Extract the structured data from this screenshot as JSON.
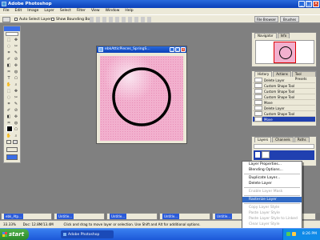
{
  "app": {
    "title": "Adobe Photoshop"
  },
  "menu": [
    "File",
    "Edit",
    "Image",
    "Layer",
    "Select",
    "Filter",
    "View",
    "Window",
    "Help"
  ],
  "options_bar": {
    "auto_select": "Auto Select Layer",
    "bounding": "Show Bounding Box",
    "tab1": "File Browser",
    "tab2": "Brushes"
  },
  "document": {
    "title": "ebkAtticPieces_SpringS..."
  },
  "navigator": {
    "tabs": [
      "Navigator",
      "Info"
    ]
  },
  "history": {
    "tabs": [
      "History",
      "Actions",
      "Tool Presets"
    ],
    "items": [
      "Delete Layer",
      "Custom Shape Tool",
      "Custom Shape Tool",
      "Custom Shape Tool",
      "Move",
      "Delete Layer",
      "Custom Shape Tool",
      "Move"
    ],
    "selected_index": 7
  },
  "layers": {
    "tabs": [
      "Layers",
      "Channels",
      "Paths"
    ]
  },
  "context_menu": {
    "items": [
      {
        "label": "Layer Properties...",
        "enabled": true
      },
      {
        "label": "Blending Options...",
        "enabled": true
      },
      {
        "sep": true
      },
      {
        "label": "Duplicate Layer...",
        "enabled": true
      },
      {
        "label": "Delete Layer",
        "enabled": true
      },
      {
        "sep": true
      },
      {
        "label": "Enable Layer Mask",
        "enabled": false
      },
      {
        "sep": true
      },
      {
        "label": "Rasterize Layer",
        "enabled": true,
        "highlight": true
      },
      {
        "sep": true
      },
      {
        "label": "Copy Layer Style",
        "enabled": false
      },
      {
        "label": "Paste Layer Style",
        "enabled": false
      },
      {
        "label": "Paste Layer Style to Linked",
        "enabled": false
      },
      {
        "label": "Clear Layer Style",
        "enabled": false
      }
    ]
  },
  "minimized_docs": [
    "ebk_Atp...",
    "Untitle...",
    "Untitle...",
    "Untitle...",
    "Untitle...",
    "Untitle..."
  ],
  "status_bar": {
    "zoom": "33.33%",
    "doc_size": "Doc: 12.8M/13.4M",
    "hint": "Click and drag to move layer or selection. Use Shift and Alt for additional options."
  },
  "taskbar": {
    "start": "start",
    "task": "Adobe Photoshop",
    "clock": "8:26 PM"
  },
  "colors": {
    "xp_blue": "#0a3fb8",
    "face": "#ece9d8",
    "highlight": "#316ac5",
    "canvas_pink": "#f2b0ce"
  }
}
